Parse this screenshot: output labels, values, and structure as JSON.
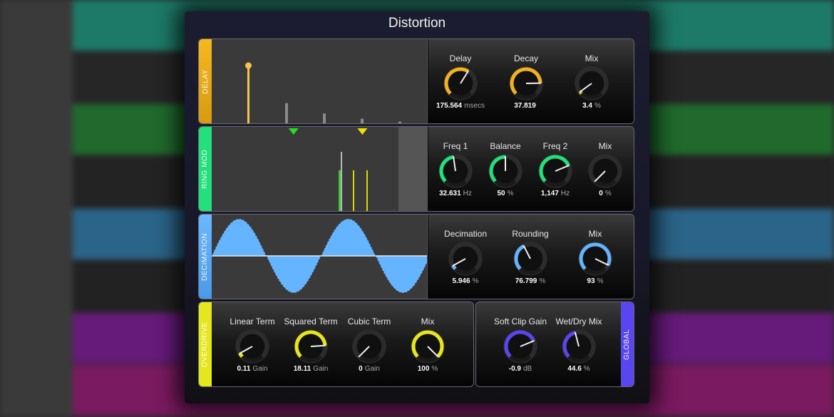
{
  "window": {
    "title": "Distortion"
  },
  "colors": {
    "delay": "#f2b120",
    "ring_mod": "#22e07c",
    "decimation": "#64b4ff",
    "overdrive": "#e6e61e",
    "global": "#5a46f0"
  },
  "background_tracks": [
    "#1d7a68",
    "#262626",
    "#1f6a2c",
    "#232323",
    "#2a6488",
    "#222222",
    "#661a7a",
    "#7a1a60"
  ],
  "sections": {
    "delay": {
      "label": "DELAY",
      "taps": [
        1.0,
        0.35,
        0.17,
        0.08,
        0.03
      ],
      "knobs": [
        {
          "label": "Delay",
          "value": "175.564",
          "unit": "msecs",
          "fraction": 0.62
        },
        {
          "label": "Decay",
          "value": "37.819",
          "unit": "",
          "fraction": 0.83
        },
        {
          "label": "Mix",
          "value": "3.4",
          "unit": "%",
          "fraction": 0.034
        }
      ]
    },
    "ring_mod": {
      "label": "RING MOD",
      "markers": [
        {
          "color": "#22e022",
          "position": 0.38
        },
        {
          "color": "#f0e000",
          "position": 0.7
        }
      ],
      "knobs": [
        {
          "label": "Freq 1",
          "value": "32.631",
          "unit": "Hz",
          "fraction": 0.47
        },
        {
          "label": "Balance",
          "value": "50",
          "unit": "%",
          "fraction": 0.5
        },
        {
          "label": "Freq 2",
          "value": "1,147",
          "unit": "Hz",
          "fraction": 0.75
        },
        {
          "label": "Mix",
          "value": "0",
          "unit": "%",
          "fraction": 0.0
        }
      ]
    },
    "decimation": {
      "label": "DECIMATION",
      "knobs": [
        {
          "label": "Decimation",
          "value": "5.946",
          "unit": "%",
          "fraction": 0.06
        },
        {
          "label": "Rounding",
          "value": "76.799",
          "unit": "%",
          "fraction": 0.4
        },
        {
          "label": "Mix",
          "value": "93",
          "unit": "%",
          "fraction": 0.93
        }
      ]
    },
    "overdrive": {
      "label": "OVERDRIVE",
      "knobs": [
        {
          "label": "Linear Term",
          "value": "0.11",
          "unit": "Gain",
          "fraction": 0.06
        },
        {
          "label": "Squared Term",
          "value": "18.11",
          "unit": "Gain",
          "fraction": 0.82
        },
        {
          "label": "Cubic Term",
          "value": "0",
          "unit": "Gain",
          "fraction": 0.0
        },
        {
          "label": "Mix",
          "value": "100",
          "unit": "%",
          "fraction": 1.0
        }
      ]
    },
    "global": {
      "label": "GLOBAL",
      "knobs": [
        {
          "label": "Soft Clip Gain",
          "value": "-0.9",
          "unit": "dB",
          "fraction": 0.75
        },
        {
          "label": "Wet/Dry Mix",
          "value": "44.6",
          "unit": "%",
          "fraction": 0.446
        }
      ]
    }
  }
}
